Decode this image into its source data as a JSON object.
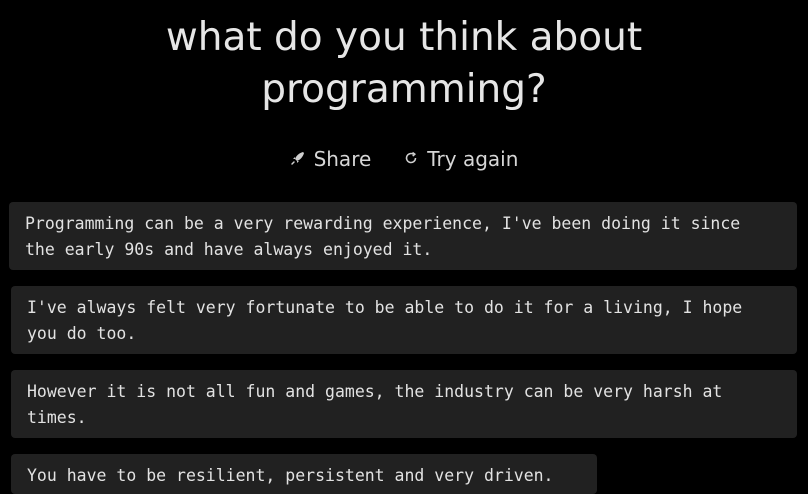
{
  "header": {
    "title_line1": "what do you think about",
    "title_line2": "programming?"
  },
  "actions": {
    "share_label": "Share",
    "share_icon": "rocket-icon",
    "try_again_label": "Try again",
    "try_again_icon": "refresh-icon"
  },
  "responses": [
    {
      "line1": "Programming can be a very rewarding experience, I've been doing it since",
      "line2": "the early 90s and have always enjoyed it."
    },
    {
      "line1": "I've always felt very fortunate to be able to do it for a living, I hope",
      "line2": "you do too."
    },
    {
      "line1": "However it is not all fun and games, the industry can be very harsh at",
      "line2": "times."
    },
    {
      "line1": "You have to be resilient, persistent and very driven.",
      "line2": ""
    }
  ],
  "colors": {
    "background": "#000000",
    "card_background": "#212121",
    "text": "#e2e2e2"
  }
}
